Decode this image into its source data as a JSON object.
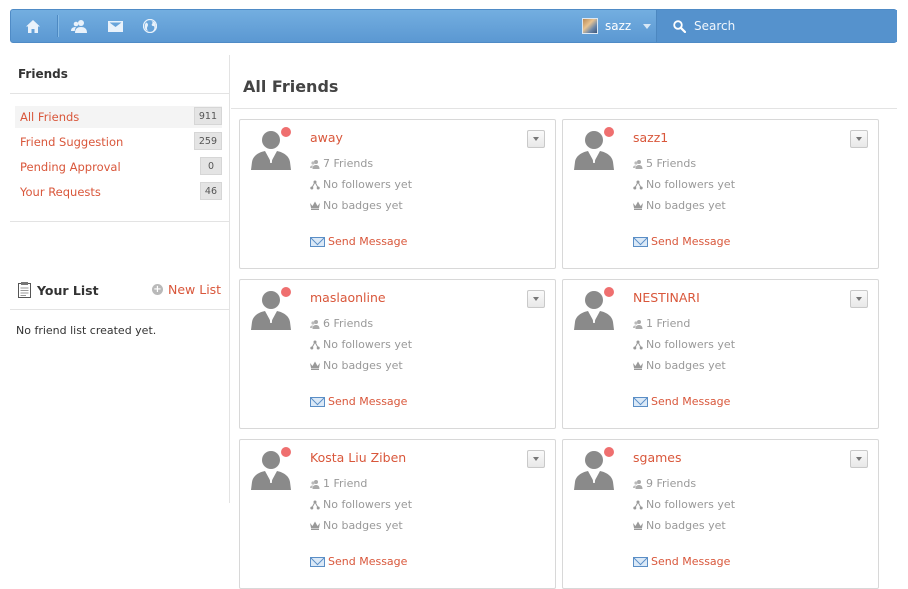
{
  "topbar": {
    "nav_icons": [
      "home-icon",
      "friends-icon",
      "mail-icon",
      "globe-icon"
    ],
    "user_name": "sazz",
    "search_placeholder": "Search"
  },
  "sidebar": {
    "title": "Friends",
    "items": [
      {
        "label": "All Friends",
        "count": "911",
        "active": true
      },
      {
        "label": "Friend Suggestion",
        "count": "259",
        "active": false
      },
      {
        "label": "Pending Approval",
        "count": "0",
        "active": false
      },
      {
        "label": "Your Requests",
        "count": "46",
        "active": false
      }
    ],
    "your_list": {
      "title": "Your List",
      "new_list_label": "New List",
      "empty_text": "No friend list created yet."
    }
  },
  "main": {
    "title": "All Friends",
    "friends": [
      {
        "name": "away",
        "friends": "7 Friends",
        "followers": "No followers yet",
        "badges": "No badges yet",
        "message": "Send Message"
      },
      {
        "name": "sazz1",
        "friends": "5 Friends",
        "followers": "No followers yet",
        "badges": "No badges yet",
        "message": "Send Message"
      },
      {
        "name": "maslaonline",
        "friends": "6 Friends",
        "followers": "No followers yet",
        "badges": "No badges yet",
        "message": "Send Message"
      },
      {
        "name": "NESTINARI",
        "friends": "1 Friend",
        "followers": "No followers yet",
        "badges": "No badges yet",
        "message": "Send Message"
      },
      {
        "name": "Kosta Liu Ziben",
        "friends": "1 Friend",
        "followers": "No followers yet",
        "badges": "No badges yet",
        "message": "Send Message"
      },
      {
        "name": "sgames",
        "friends": "9 Friends",
        "followers": "No followers yet",
        "badges": "No badges yet",
        "message": "Send Message"
      }
    ]
  },
  "colors": {
    "topbar": "#5b98d2",
    "link": "#d9573b",
    "online_dot": "#ef6f6f"
  }
}
